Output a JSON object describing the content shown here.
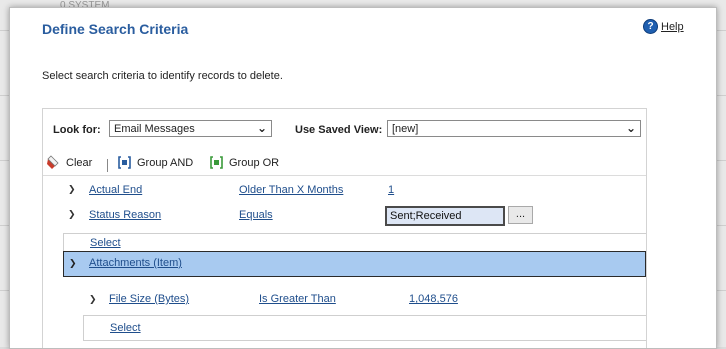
{
  "background": {
    "text": "0 SYSTEM"
  },
  "dialog": {
    "title": "Define Search Criteria",
    "help_label": "Help",
    "subtitle": "Select search criteria to identify records to delete."
  },
  "criteria": {
    "look_for_label": "Look for:",
    "look_for_value": "Email Messages",
    "saved_view_label": "Use Saved View:",
    "saved_view_value": "[new]"
  },
  "toolbar": {
    "clear_label": "Clear",
    "group_and_label": "Group AND",
    "group_or_label": "Group OR"
  },
  "rows": [
    {
      "field": "Actual End",
      "operator": "Older Than X Months",
      "value": "1"
    },
    {
      "field": "Status Reason",
      "operator": "Equals",
      "value": "Sent;Received",
      "button": "..."
    }
  ],
  "select_link": "Select",
  "related_entity": {
    "label": "Attachments (Item)",
    "rows": [
      {
        "field": "File Size (Bytes)",
        "operator": "Is Greater Than",
        "value": "1,048,576"
      }
    ],
    "select_link": "Select"
  },
  "colors": {
    "title": "#2a5d9f",
    "link": "#1f4e8c",
    "selected_band": "#a8caf0",
    "input_highlight": "#dde6f5"
  }
}
